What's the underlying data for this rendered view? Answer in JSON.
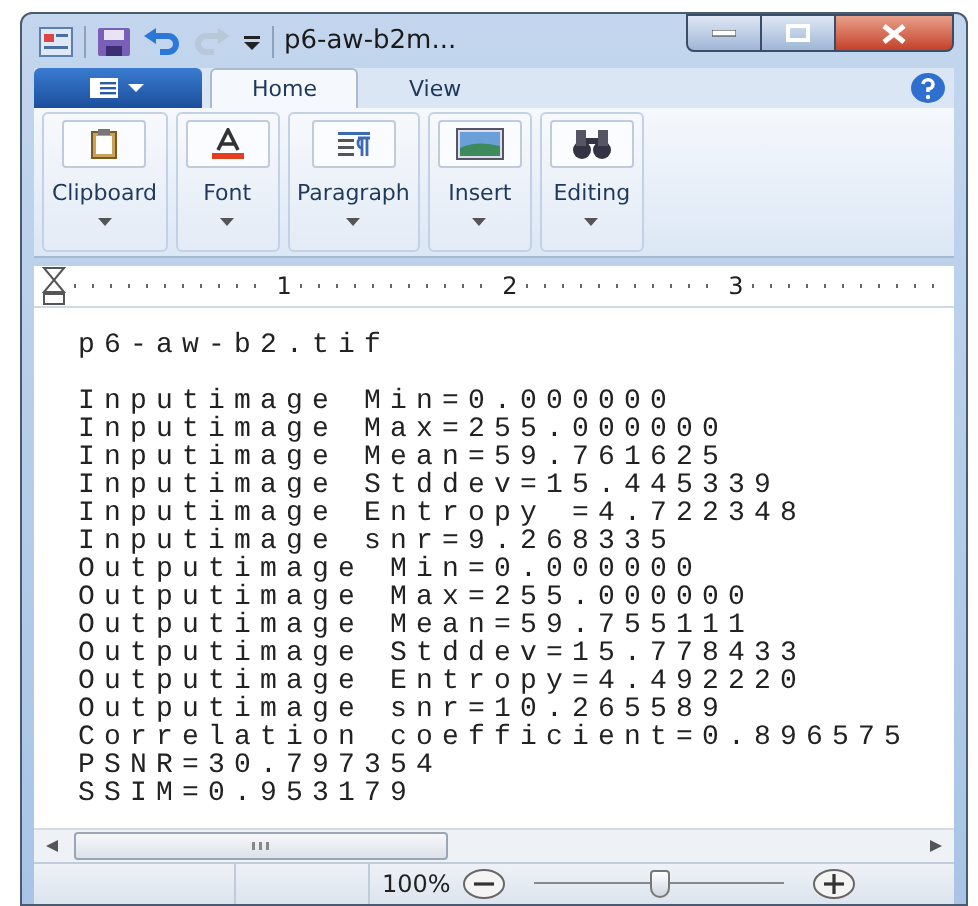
{
  "window": {
    "title": "p6-aw-b2m..."
  },
  "ribbon": {
    "tabs": [
      {
        "label": "Home",
        "selected": true
      },
      {
        "label": "View",
        "selected": false
      }
    ],
    "groups": [
      {
        "label": "Clipboard",
        "kind": "clipboard"
      },
      {
        "label": "Font",
        "kind": "font"
      },
      {
        "label": "Paragraph",
        "kind": "paragraph"
      },
      {
        "label": "Insert",
        "kind": "insert"
      },
      {
        "label": "Editing",
        "kind": "editing"
      }
    ]
  },
  "ruler": {
    "numbers": [
      "1",
      "2",
      "3"
    ]
  },
  "document": {
    "filename": "p6-aw-b2.tif",
    "lines": [
      "Inputimage Min=0.000000",
      "Inputimage Max=255.000000",
      "Inputimage Mean=59.761625",
      "Inputimage Stddev=15.445339",
      "Inputimage Entropy =4.722348",
      "Inputimage snr=9.268335",
      "Outputimage Min=0.000000",
      "Outputimage Max=255.000000",
      "Outputimage Mean=59.755111",
      "Outputimage Stddev=15.778433",
      "Outputimage Entropy=4.492220",
      "Outputimage snr=10.265589",
      "Correlation coefficient=0.896575",
      "PSNR=30.797354",
      "SSIM=0.953179"
    ]
  },
  "status_bar": {
    "zoom": "100%",
    "level": 0.5
  }
}
